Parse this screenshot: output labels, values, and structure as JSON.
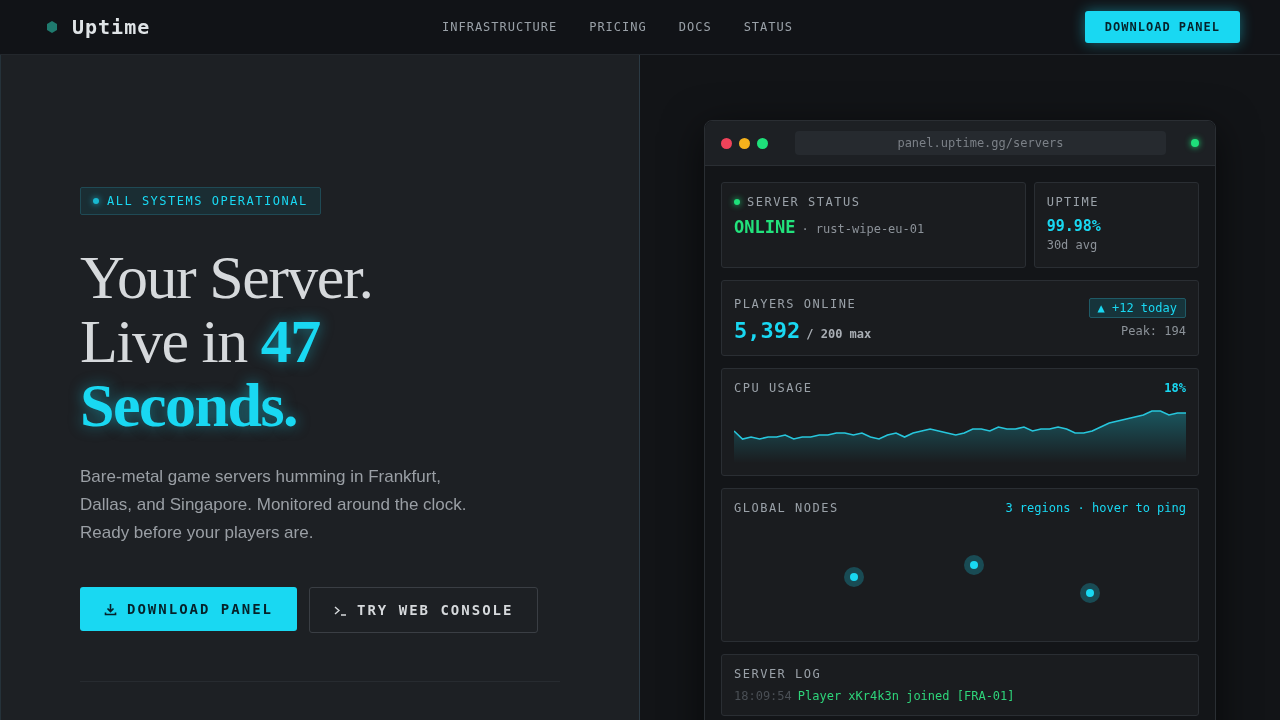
{
  "nav": {
    "brand": "Uptime",
    "links": [
      "INFRASTRUCTURE",
      "PRICING",
      "DOCS",
      "STATUS"
    ],
    "cta": "DOWNLOAD PANEL"
  },
  "hero": {
    "badge": "ALL SYSTEMS OPERATIONAL",
    "heading": [
      {
        "segments": [
          {
            "text": "Your Server.",
            "accent": false
          }
        ]
      },
      {
        "segments": [
          {
            "text": "Live in",
            "accent": false
          },
          {
            "text": "47",
            "accent": true
          }
        ]
      },
      {
        "segments": [
          {
            "text": "Seconds.",
            "accent": true
          }
        ]
      }
    ],
    "description": "Bare-metal game servers humming in Frankfurt, Dallas, and Singapore. Monitored around the clock. Ready before your players are.",
    "buttons": [
      {
        "kind": "primary",
        "label": "DOWNLOAD PANEL"
      },
      {
        "kind": "secondary",
        "label": "TRY WEB CONSOLE"
      }
    ]
  },
  "panel": {
    "url": "panel.uptime.gg/servers",
    "server_status": {
      "title": "SERVER STATUS",
      "state": "ONLINE",
      "host": "· rust-wipe-eu-01"
    },
    "uptime": {
      "title": "UPTIME",
      "value": "99.98%",
      "note": "30d avg"
    },
    "players": {
      "title": "PLAYERS ONLINE",
      "count": "5,392",
      "max": "/ 200 max",
      "trend": "▲ +12 today",
      "peak": "Peak: 194"
    },
    "cpu": {
      "title": "CPU USAGE",
      "value": "18%"
    },
    "nodes": {
      "title": "GLOBAL NODES",
      "hint": "3 regions · hover to ping"
    },
    "log": {
      "title": "SERVER LOG",
      "entries": [
        {
          "time": "18:09:54",
          "message": "Player xKr4k3n joined [FRA-01]"
        }
      ]
    }
  }
}
